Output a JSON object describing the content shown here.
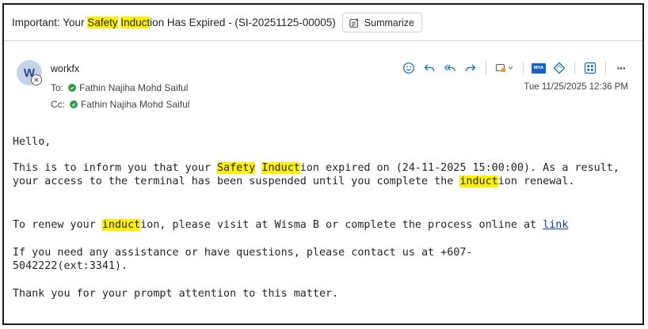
{
  "email": {
    "subject": {
      "prefix": "Important: Your ",
      "hl1": "Safety",
      "space": " ",
      "hl2": "Induct",
      "suffix": "ion Has Expired - (SI-20251125-00005)"
    },
    "summarize_label": "Summarize",
    "sender": {
      "avatar_initial": "W",
      "name": "workfx",
      "to_label": "To:",
      "to_name": "Fathin Najiha Mohd Saiful",
      "cc_label": "Cc:",
      "cc_name": "Fathin Najiha Mohd Saiful"
    },
    "date": "Tue 11/25/2025 12:36 PM",
    "toolbar_icons": [
      "emoji-icon",
      "reply-icon",
      "reply-all-icon",
      "forward-icon",
      "tags-icon",
      "mha-icon",
      "diamond-icon",
      "apps-icon",
      "more-icon"
    ],
    "mha_label": "MHA",
    "more_label": "···",
    "body": {
      "greeting": "Hello,",
      "p1_a": "This is to inform you that your ",
      "p1_hl1": "Safety",
      "p1_sp": " ",
      "p1_hl2": "Induct",
      "p1_b": "ion expired on (24-11-2025 15:00:00). As a result, your access to the terminal has been suspended until you complete the ",
      "p1_hl3": "induct",
      "p1_c": "ion renewal.",
      "p2_a": "To renew your ",
      "p2_hl": "induct",
      "p2_b": "ion, please visit at Wisma B or complete the process online at ",
      "p2_link": "link",
      "p3": "If you need any assistance or have questions, please contact us at +607-5042222(ext:3341).",
      "p4": "Thank you for your prompt attention to this matter."
    }
  },
  "colors": {
    "highlight": "#fff100",
    "link": "#0f38c2",
    "accent": "#0f6cbd",
    "presence": "#2e9e44"
  }
}
